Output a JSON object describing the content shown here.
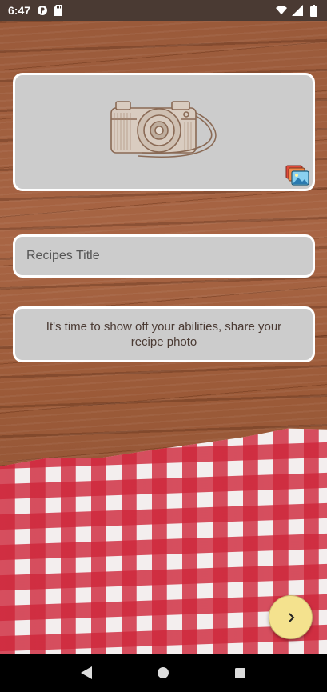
{
  "status_bar": {
    "time": "6:47",
    "left_icons": [
      "p-circle-icon",
      "sd-card-icon"
    ],
    "right_icons": [
      "wifi-icon",
      "signal-icon",
      "battery-icon"
    ]
  },
  "photo_picker": {
    "placeholder_image": "camera-sketch-icon",
    "action_icon": "gallery-icon"
  },
  "title_field": {
    "value": "",
    "placeholder": "Recipes Title"
  },
  "description": {
    "text": "It's time to show off your abilities, share your recipe photo"
  },
  "fab": {
    "icon": "chevron-right-icon",
    "color": "#f4e28e"
  },
  "nav_bar": {
    "items": [
      "back-icon",
      "home-icon",
      "recents-icon"
    ]
  },
  "colors": {
    "status_bar": "#4a3a33",
    "card": "#cccccc",
    "text_brown": "#4a3a33",
    "check_red": "#ce263a"
  }
}
